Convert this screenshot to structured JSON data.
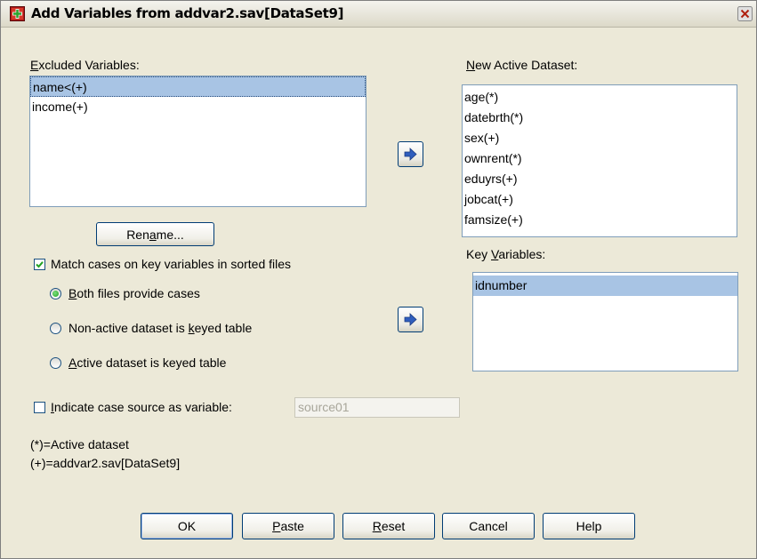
{
  "window": {
    "title": "Add Variables from addvar2.sav[DataSet9]"
  },
  "excluded": {
    "label_pre": "",
    "label_u": "E",
    "label_post": "xcluded Variables:",
    "items": [
      "name<(+)",
      "income(+)"
    ]
  },
  "active": {
    "label_pre": "",
    "label_u": "N",
    "label_post": "ew Active Dataset:",
    "items": [
      "age(*)",
      "datebrth(*)",
      "sex(+)",
      "ownrent(*)",
      "eduyrs(+)",
      "jobcat(+)",
      "famsize(+)"
    ]
  },
  "key": {
    "label_pre": "Key ",
    "label_u": "V",
    "label_post": "ariables:",
    "items": [
      "idnumber"
    ]
  },
  "rename_button": {
    "pre": "Ren",
    "u": "a",
    "post": "me..."
  },
  "match_cases": {
    "label": "Match cases on key variables in sorted files",
    "checked": true
  },
  "radios": [
    {
      "pre": "",
      "u": "B",
      "post": "oth files provide cases",
      "selected": true
    },
    {
      "pre": "Non-active dataset is ",
      "u": "k",
      "post": "eyed table",
      "selected": false
    },
    {
      "pre": "",
      "u": "A",
      "post": "ctive dataset is keyed table",
      "selected": false
    }
  ],
  "indicate_source": {
    "pre": "",
    "u": "I",
    "post": "ndicate case source as variable:",
    "checked": false,
    "value": "source01"
  },
  "legend": {
    "line1": "(*)=Active dataset",
    "line2": "(+)=addvar2.sav[DataSet9]"
  },
  "buttons": {
    "ok": "OK",
    "paste": {
      "pre": "",
      "u": "P",
      "post": "aste"
    },
    "reset": {
      "pre": "",
      "u": "R",
      "post": "eset"
    },
    "cancel": "Cancel",
    "help": "Help"
  },
  "icons": [
    "app-icon",
    "close-icon",
    "arrow-right-icon",
    "checkmark-icon"
  ],
  "colors": {
    "selection": "#a8c4e4",
    "listbox_border": "#7f9db9",
    "dialog_bg": "#ece9d8"
  }
}
